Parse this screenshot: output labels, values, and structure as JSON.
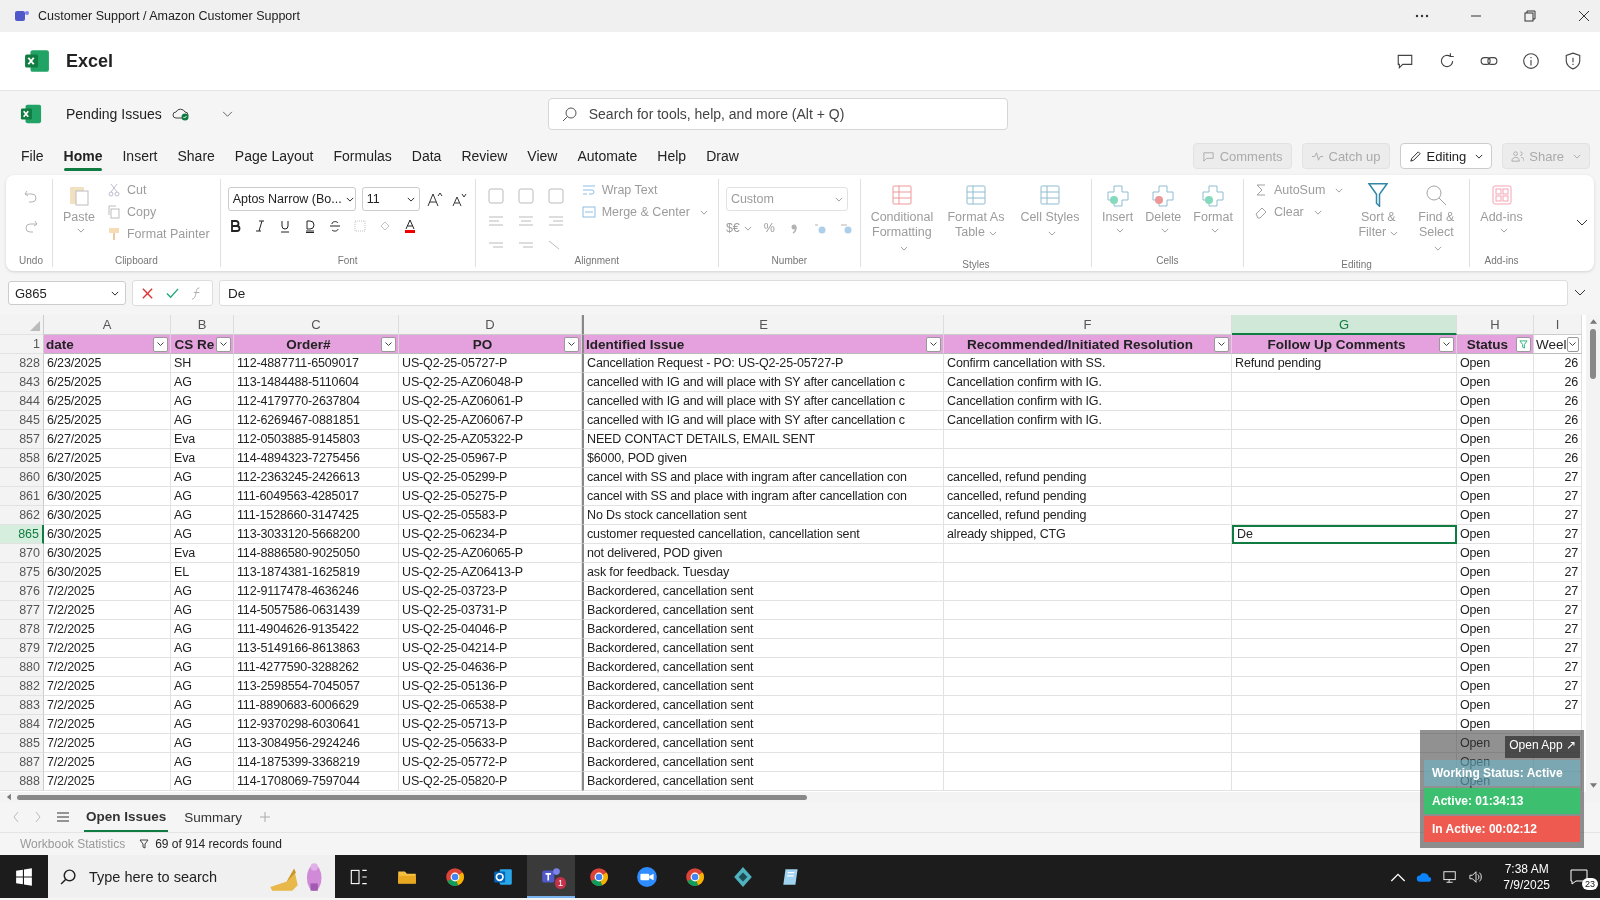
{
  "window": {
    "title": "Customer Support / Amazon Customer Support"
  },
  "app": {
    "name": "Excel"
  },
  "file": {
    "name": "Pending Issues"
  },
  "search": {
    "placeholder": "Search for tools, help, and more (Alt + Q)"
  },
  "menu_tabs": [
    {
      "label": "File",
      "selected": false
    },
    {
      "label": "Home",
      "selected": true
    },
    {
      "label": "Insert",
      "selected": false
    },
    {
      "label": "Share",
      "selected": false
    },
    {
      "label": "Page Layout",
      "selected": false
    },
    {
      "label": "Formulas",
      "selected": false
    },
    {
      "label": "Data",
      "selected": false
    },
    {
      "label": "Review",
      "selected": false
    },
    {
      "label": "View",
      "selected": false
    },
    {
      "label": "Automate",
      "selected": false
    },
    {
      "label": "Help",
      "selected": false
    },
    {
      "label": "Draw",
      "selected": false
    }
  ],
  "header_buttons": [
    {
      "label": "Comments",
      "disabled": true
    },
    {
      "label": "Catch up",
      "disabled": true
    },
    {
      "label": "Editing",
      "disabled": false
    },
    {
      "label": "Share",
      "disabled": true
    }
  ],
  "ribbon": {
    "undo": {
      "label": "Undo",
      "disabled": true
    },
    "clipboard": {
      "label": "Clipboard",
      "disabled": true,
      "paste": "Paste",
      "cut": "Cut",
      "copy": "Copy",
      "format_painter": "Format Painter"
    },
    "font": {
      "label": "Font",
      "disabled": false,
      "family": "Aptos Narrow (Bo...",
      "size": "11"
    },
    "alignment": {
      "label": "Alignment",
      "disabled": true,
      "wrap_text": "Wrap Text",
      "merge": "Merge & Center"
    },
    "number": {
      "label": "Number",
      "disabled": true,
      "format": "Custom",
      "currency": "$€",
      "percent": "%"
    },
    "styles": {
      "label": "Styles",
      "disabled": true,
      "buttons": [
        "Conditional Formatting",
        "Format As Table",
        "Cell Styles"
      ]
    },
    "cells": {
      "label": "Cells",
      "disabled": true,
      "buttons": [
        "Insert",
        "Delete",
        "Format"
      ]
    },
    "editing": {
      "label": "Editing",
      "disabled": true,
      "autosum": "AutoSum",
      "clear": "Clear",
      "buttons": [
        "Sort & Filter",
        "Find & Select"
      ]
    },
    "addins": {
      "label": "Add-ins",
      "disabled": true,
      "buttons": [
        "Add-ins"
      ]
    }
  },
  "formula_bar": {
    "name_box": "G865",
    "value": "De"
  },
  "columns": [
    {
      "letter": "A",
      "header": "date",
      "filtered": false,
      "selected": false,
      "color": "#e4a1de"
    },
    {
      "letter": "B",
      "header": "CS Re",
      "filtered": false,
      "selected": false,
      "color": "#e4a1de"
    },
    {
      "letter": "C",
      "header": "Order#",
      "filtered": false,
      "selected": false,
      "color": "#e4a1de"
    },
    {
      "letter": "D",
      "header": "PO",
      "filtered": false,
      "selected": false,
      "color": "#e4a1de"
    },
    {
      "letter": "E",
      "header": "Identified Issue",
      "filtered": false,
      "selected": false,
      "color": "#e4a1de"
    },
    {
      "letter": "F",
      "header": "Recommended/Initiated Resolution",
      "filtered": false,
      "selected": false,
      "color": "#e4a1de"
    },
    {
      "letter": "G",
      "header": "Follow Up Comments",
      "filtered": false,
      "selected": true,
      "color": "#e4a1de"
    },
    {
      "letter": "H",
      "header": "Status",
      "filtered": true,
      "selected": false,
      "color": "#e4a1de"
    },
    {
      "letter": "I",
      "header": "Weel",
      "filtered": false,
      "selected": false,
      "color": "#ffffff"
    }
  ],
  "header_row_number": "1",
  "rows": [
    {
      "row": "828",
      "selected": false,
      "date": "6/23/2025",
      "cs_rep": "SH",
      "order": "112-4887711-6509017",
      "po": "US-Q2-25-05727-P",
      "issue": "Cancellation Request - PO: US-Q2-25-05727-P",
      "resolution": "Confirm cancellation with SS.",
      "comment": "Refund pending",
      "status": "Open",
      "week": "26"
    },
    {
      "row": "843",
      "selected": false,
      "date": "6/25/2025",
      "cs_rep": "AG",
      "order": "113-1484488-5110604",
      "po": "US-Q2-25-AZ06048-P",
      "issue": "cancelled with IG and will place with SY after cancellation c",
      "resolution": "Cancellation confirm with IG.",
      "status": "Open",
      "week": "26"
    },
    {
      "row": "844",
      "selected": false,
      "date": "6/25/2025",
      "cs_rep": "AG",
      "order": "112-4179770-2637804",
      "po": "US-Q2-25-AZ06061-P",
      "issue": "cancelled with IG and will place with SY after cancellation c",
      "resolution": "Cancellation confirm with IG.",
      "status": "Open",
      "week": "26"
    },
    {
      "row": "845",
      "selected": false,
      "date": "6/25/2025",
      "cs_rep": "AG",
      "order": "112-6269467-0881851",
      "po": "US-Q2-25-AZ06067-P",
      "issue": "cancelled with IG and will place with SY after cancellation c",
      "resolution": "Cancellation confirm with IG.",
      "status": "Open",
      "week": "26"
    },
    {
      "row": "857",
      "selected": false,
      "date": "6/27/2025",
      "cs_rep": "Eva",
      "order": "112-0503885-9145803",
      "po": "US-Q2-25-AZ05322-P",
      "issue": "NEED CONTACT DETAILS, EMAIL SENT",
      "status": "Open",
      "week": "26"
    },
    {
      "row": "858",
      "selected": false,
      "date": "6/27/2025",
      "cs_rep": "Eva",
      "order": "114-4894323-7275456",
      "po": "US-Q2-25-05967-P",
      "issue": "$6000, POD given",
      "status": "Open",
      "week": "26"
    },
    {
      "row": "860",
      "selected": false,
      "date": "6/30/2025",
      "cs_rep": "AG",
      "order": "112-2363245-2426613",
      "po": "US-Q2-25-05299-P",
      "issue": "cancel with SS and place with ingram after cancellation con",
      "resolution": "cancelled, refund pending",
      "status": "Open",
      "week": "27"
    },
    {
      "row": "861",
      "selected": false,
      "date": "6/30/2025",
      "cs_rep": "AG",
      "order": "111-6049563-4285017",
      "po": "US-Q2-25-05275-P",
      "issue": "cancel with SS and place with ingram after cancellation con",
      "resolution": "cancelled, refund pending",
      "status": "Open",
      "week": "27"
    },
    {
      "row": "862",
      "selected": false,
      "date": "6/30/2025",
      "cs_rep": "AG",
      "order": "111-1528660-3147425",
      "po": "US-Q2-25-05583-P",
      "issue": "No Ds stock cancellation sent",
      "resolution": "cancelled, refund pending",
      "status": "Open",
      "week": "27"
    },
    {
      "row": "865",
      "selected": true,
      "date": "6/30/2025",
      "cs_rep": "AG",
      "order": "113-3033120-5668200",
      "po": "US-Q2-25-06234-P",
      "issue": "customer requested cancellation, cancellation sent",
      "resolution": "already shipped, CTG",
      "comment": "De",
      "status": "Open",
      "week": "27"
    },
    {
      "row": "870",
      "selected": false,
      "date": "6/30/2025",
      "cs_rep": "Eva",
      "order": "114-8886580-9025050",
      "po": "US-Q2-25-AZ06065-P",
      "issue": "not delivered, POD given",
      "status": "Open",
      "week": "27"
    },
    {
      "row": "875",
      "selected": false,
      "date": "6/30/2025",
      "cs_rep": "EL",
      "order": "113-1874381-1625819",
      "po": "US-Q2-25-AZ06413-P",
      "issue": "ask for feedback. Tuesday",
      "status": "Open",
      "week": "27"
    },
    {
      "row": "876",
      "selected": false,
      "date": "7/2/2025",
      "cs_rep": "AG",
      "order": "112-9117478-4636246",
      "po": "US-Q2-25-03723-P",
      "issue": "Backordered, cancellation sent",
      "status": "Open",
      "week": "27"
    },
    {
      "row": "877",
      "selected": false,
      "date": "7/2/2025",
      "cs_rep": "AG",
      "order": "114-5057586-0631439",
      "po": "US-Q2-25-03731-P",
      "issue": "Backordered, cancellation sent",
      "status": "Open",
      "week": "27"
    },
    {
      "row": "878",
      "selected": false,
      "date": "7/2/2025",
      "cs_rep": "AG",
      "order": "111-4904626-9135422",
      "po": "US-Q2-25-04046-P",
      "issue": "Backordered, cancellation sent",
      "status": "Open",
      "week": "27"
    },
    {
      "row": "879",
      "selected": false,
      "date": "7/2/2025",
      "cs_rep": "AG",
      "order": "113-5149166-8613863",
      "po": "US-Q2-25-04214-P",
      "issue": "Backordered, cancellation sent",
      "status": "Open",
      "week": "27"
    },
    {
      "row": "880",
      "selected": false,
      "date": "7/2/2025",
      "cs_rep": "AG",
      "order": "111-4277590-3288262",
      "po": "US-Q2-25-04636-P",
      "issue": "Backordered, cancellation sent",
      "status": "Open",
      "week": "27"
    },
    {
      "row": "882",
      "selected": false,
      "date": "7/2/2025",
      "cs_rep": "AG",
      "order": "113-2598554-7045057",
      "po": "US-Q2-25-05136-P",
      "issue": "Backordered, cancellation sent",
      "status": "Open",
      "week": "27"
    },
    {
      "row": "883",
      "selected": false,
      "date": "7/2/2025",
      "cs_rep": "AG",
      "order": "111-8890683-6006629",
      "po": "US-Q2-25-06538-P",
      "issue": "Backordered, cancellation sent",
      "status": "Open",
      "week": "27"
    },
    {
      "row": "884",
      "selected": false,
      "date": "7/2/2025",
      "cs_rep": "AG",
      "order": "112-9370298-6030641",
      "po": "US-Q2-25-05713-P",
      "issue": "Backordered, cancellation sent",
      "status": "Open"
    },
    {
      "row": "885",
      "selected": false,
      "date": "7/2/2025",
      "cs_rep": "AG",
      "order": "113-3084956-2924246",
      "po": "US-Q2-25-05633-P",
      "issue": "Backordered, cancellation sent",
      "status": "Open"
    },
    {
      "row": "887",
      "selected": false,
      "date": "7/2/2025",
      "cs_rep": "AG",
      "order": "114-1875399-3368219",
      "po": "US-Q2-25-05772-P",
      "issue": "Backordered, cancellation sent",
      "status": "Open"
    },
    {
      "row": "888",
      "selected": false,
      "date": "7/2/2025",
      "cs_rep": "AG",
      "order": "114-1708069-7597044",
      "po": "US-Q2-25-05820-P",
      "issue": "Backordered, cancellation sent",
      "status": "Open"
    }
  ],
  "sheet_tabs": [
    {
      "label": "Open Issues",
      "selected": true
    },
    {
      "label": "Summary",
      "selected": false
    }
  ],
  "status_bar": {
    "statistics": "Workbook Statistics",
    "records": "69 of 914 records found"
  },
  "tracker": {
    "open_app": "Open App ↗",
    "working_status": "Working Status: Active",
    "active": "Active: 01:34:13",
    "inactive": "In Active: 00:02:12"
  },
  "taskbar": {
    "search_placeholder": "Type here to search",
    "teams_badge": "1",
    "time": "7:38 AM",
    "date": "7/9/2025",
    "notifications": "23"
  }
}
